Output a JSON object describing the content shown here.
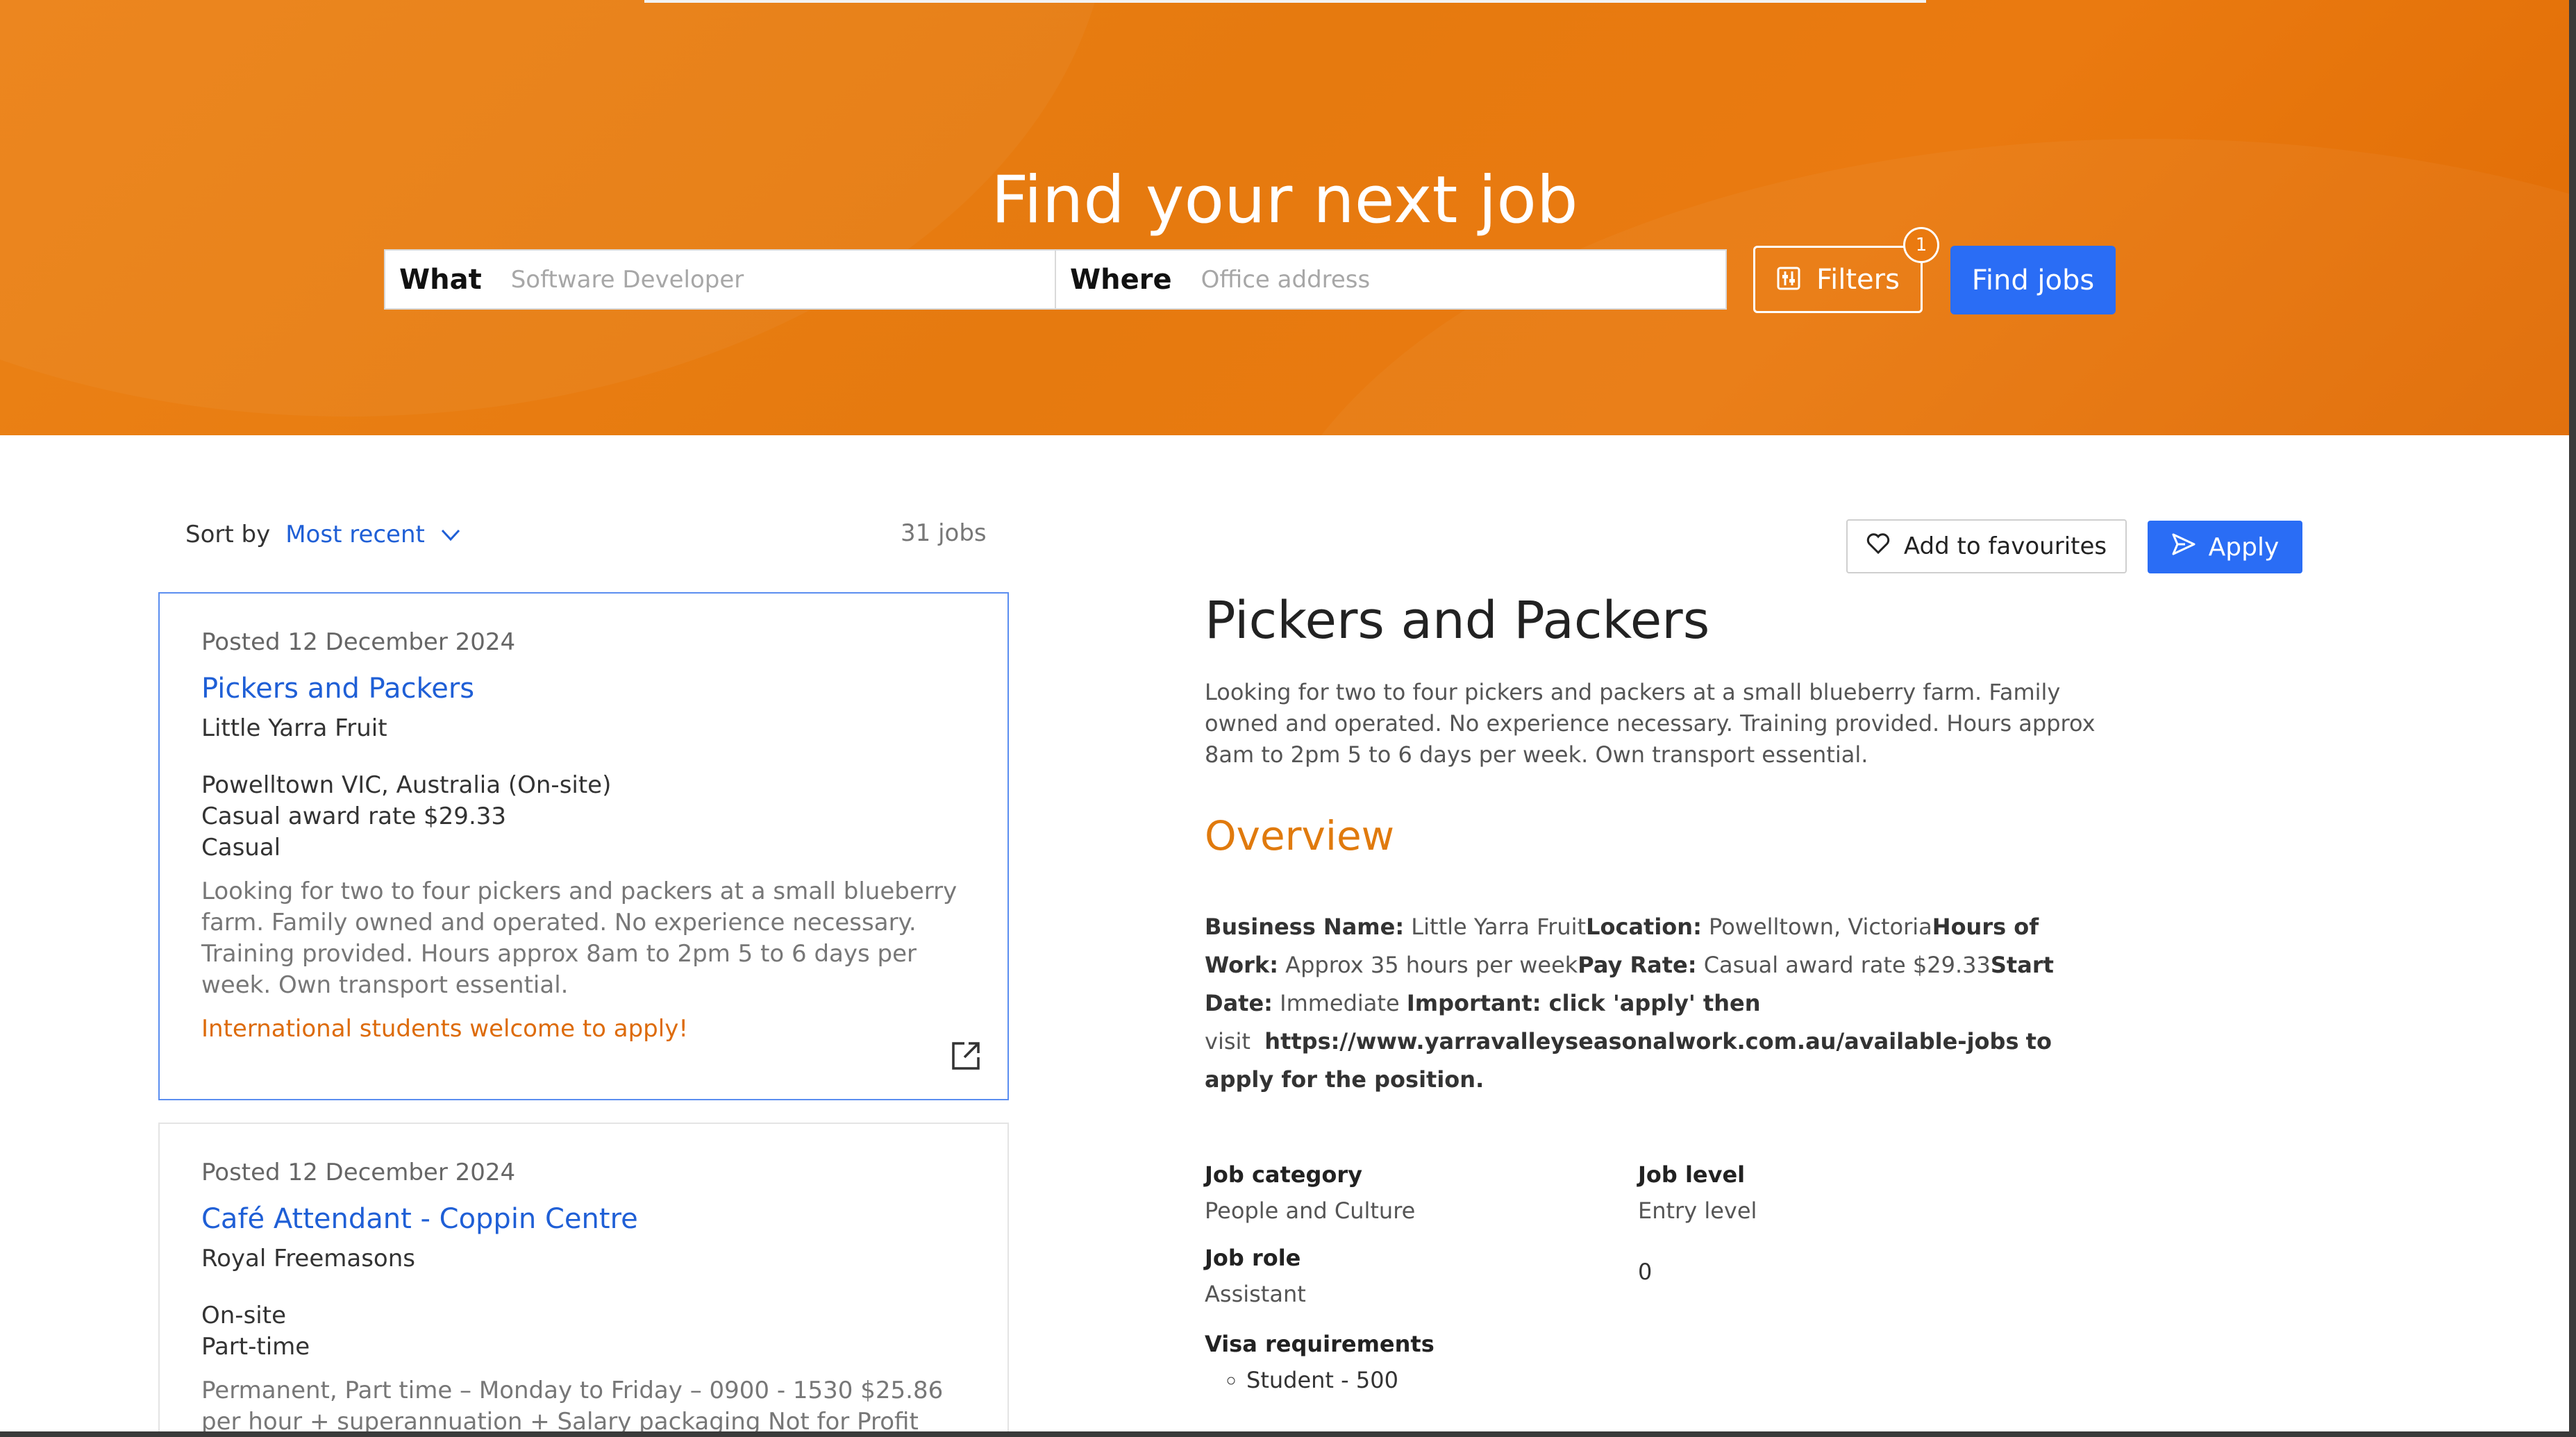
{
  "hero": {
    "title": "Find your next job",
    "search": {
      "what_label": "What",
      "what_placeholder": "Software Developer",
      "where_label": "Where",
      "where_placeholder": "Office address"
    },
    "filters_label": "Filters",
    "filters_count": "1",
    "find_label": "Find jobs"
  },
  "results": {
    "sort_label": "Sort by",
    "sort_value": "Most recent",
    "count": "31 jobs",
    "jobs": [
      {
        "posted": "Posted 12 December 2024",
        "title": "Pickers and Packers",
        "company": "Little Yarra Fruit",
        "location": "Powelltown VIC, Australia (On-site)",
        "pay": "Casual award rate $29.33",
        "type": "Casual",
        "description": "Looking for two to four pickers and packers at a small blueberry farm. Family owned and operated. No experience necessary. Training provided. Hours approx 8am to 2pm 5 to 6 days per week. Own transport essential.",
        "note": "International students welcome to apply!"
      },
      {
        "posted": "Posted 12 December 2024",
        "title": "Café Attendant - Coppin Centre",
        "company": "Royal Freemasons",
        "location": "On-site",
        "type": "Part-time",
        "description": "Permanent, Part time – Monday to Friday – 0900 - 1530 $25.86 per hour + superannuation + Salary packaging Not for Profit Salary"
      }
    ]
  },
  "detail": {
    "fav_label": "Add to favourites",
    "apply_label": "Apply",
    "title": "Pickers and Packers",
    "summary": "Looking for two to four pickers and packers at a small blueberry farm. Family owned and operated. No experience necessary. Training provided. Hours approx 8am to 2pm 5 to 6 days per week. Own transport essential.",
    "overview_heading": "Overview",
    "overview": {
      "business_label": "Business Name:",
      "business_value": "Little Yarra Fruit",
      "location_label": "Location:",
      "location_value": "Powelltown, Victoria",
      "hours_label": "Hours of Work:",
      "hours_value": "Approx 35 hours per week",
      "pay_label": "Pay Rate:",
      "pay_value": "Casual award rate $29.33",
      "start_label": "Start Date:",
      "start_value": "Immediate",
      "important_label": "Important: click 'apply' then",
      "visit": "visit",
      "url": "https://www.yarravalleyseasonalwork.com.au/available-jobs",
      "tail": "to apply for the position."
    },
    "job_category_label": "Job category",
    "job_category_value": "People and Culture",
    "job_level_label": "Job level",
    "job_level_value": "Entry level",
    "job_role_label": "Job role",
    "job_role_value": "Assistant",
    "extra_value": "0",
    "visa_label": "Visa requirements",
    "visa_items": [
      "Student - 500"
    ]
  }
}
